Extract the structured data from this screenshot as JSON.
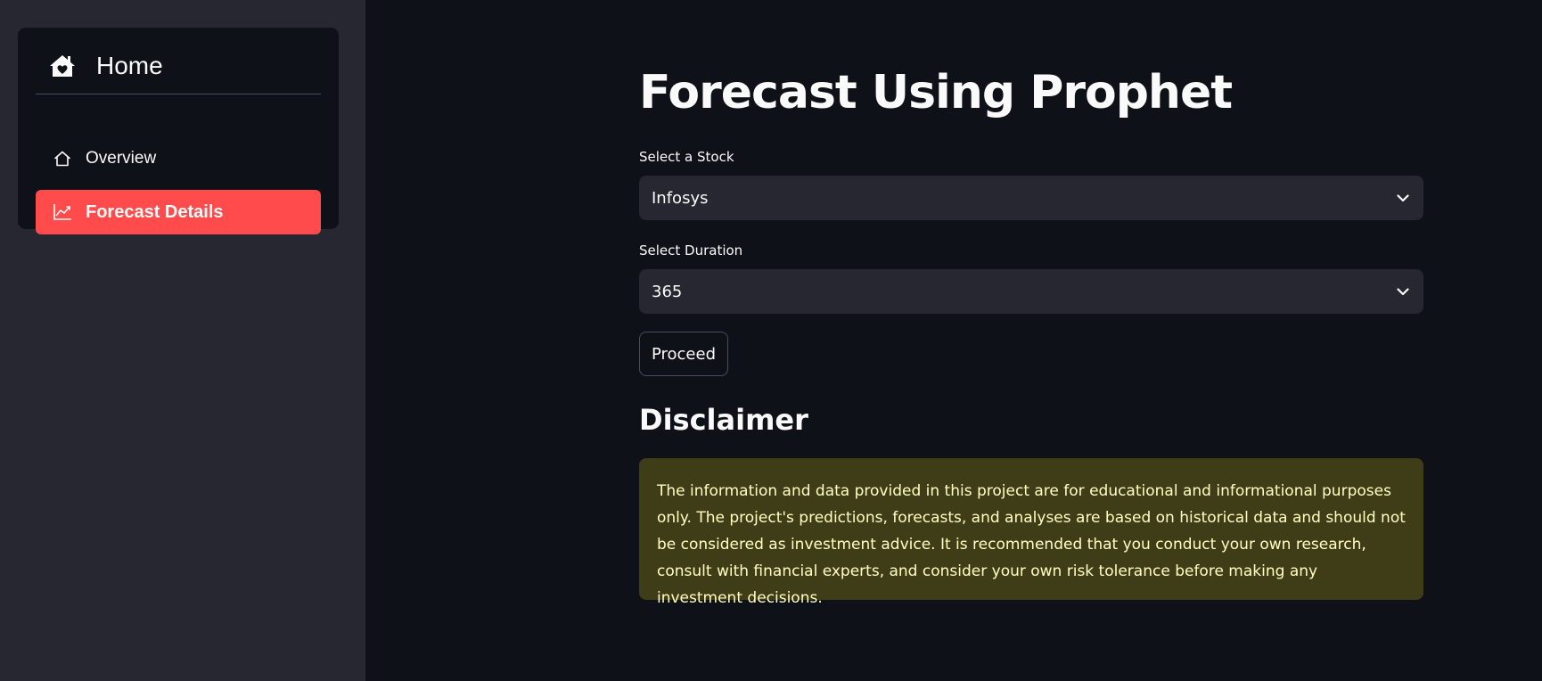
{
  "sidebar": {
    "header": {
      "title": "Home",
      "icon": "house-heart-icon"
    },
    "items": [
      {
        "label": "Overview",
        "icon": "house-icon",
        "active": false
      },
      {
        "label": "Forecast Details",
        "icon": "graph-up-icon",
        "active": true
      }
    ],
    "colors": {
      "active_bg": "#ff4b4b",
      "sidebar_bg": "#262730",
      "card_bg": "#0e1117"
    }
  },
  "main": {
    "title": "Forecast Using Prophet",
    "stock": {
      "label": "Select a Stock",
      "value": "Infosys"
    },
    "duration": {
      "label": "Select Duration",
      "value": "365"
    },
    "proceed_label": "Proceed",
    "disclaimer": {
      "title": "Disclaimer",
      "text": "The information and data provided in this project are for educational and informational purposes only. The project's predictions, forecasts, and analyses are based on historical data and should not be considered as investment advice. It is recommended that you conduct your own research, consult with financial experts, and consider your own risk tolerance before making any investment decisions."
    }
  }
}
